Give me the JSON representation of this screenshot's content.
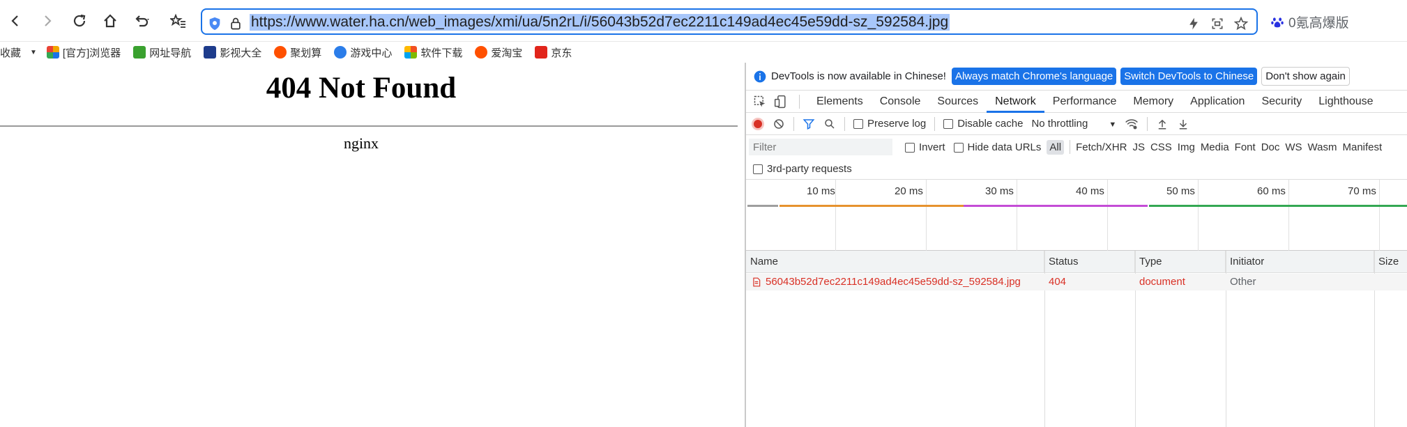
{
  "browser": {
    "url": "https://www.water.ha.cn/web_images/xmi/ua/5n2rL/i/56043b52d7ec2211c149ad4ec45e59dd-sz_592584.jpg",
    "search_text": "0氪高爆版"
  },
  "bookmarks": [
    {
      "label": "收藏",
      "icon": "star-folder-icon",
      "color": "#f2a600"
    },
    {
      "label": "[官方]浏览器",
      "icon": "grid-icon",
      "color": "#f2a600"
    },
    {
      "label": "网址导航",
      "icon": "2345-icon",
      "color": "#3aa12f"
    },
    {
      "label": "影视大全",
      "icon": "film-icon",
      "color": "#1e6cd8"
    },
    {
      "label": "聚划算",
      "icon": "taobao-icon",
      "color": "#ff5000"
    },
    {
      "label": "游戏中心",
      "icon": "game-icon",
      "color": "#2b7de9"
    },
    {
      "label": "软件下载",
      "icon": "apps-icon",
      "color": "#f25022"
    },
    {
      "label": "爱淘宝",
      "icon": "taobao-icon",
      "color": "#ff5000"
    },
    {
      "label": "京东",
      "icon": "jd-icon",
      "color": "#e1251b"
    }
  ],
  "page": {
    "title": "404 Not Found",
    "server": "nginx"
  },
  "devtools": {
    "info": "DevTools is now available in Chinese!",
    "btn_match": "Always match Chrome's language",
    "btn_switch": "Switch DevTools to Chinese",
    "btn_dismiss": "Don't show again",
    "tabs": [
      "Elements",
      "Console",
      "Sources",
      "Network",
      "Performance",
      "Memory",
      "Application",
      "Security",
      "Lighthouse"
    ],
    "active_tab": "Network",
    "preserve_log": "Preserve log",
    "disable_cache": "Disable cache",
    "throttling": "No throttling",
    "filter_placeholder": "Filter",
    "invert": "Invert",
    "hide_data_urls": "Hide data URLs",
    "filter_types": [
      "All",
      "Fetch/XHR",
      "JS",
      "CSS",
      "Img",
      "Media",
      "Font",
      "Doc",
      "WS",
      "Wasm",
      "Manifest"
    ],
    "third_party": "3rd-party requests",
    "ticks": [
      "10 ms",
      "20 ms",
      "30 ms",
      "40 ms",
      "50 ms",
      "60 ms",
      "70 ms"
    ],
    "columns": {
      "name": "Name",
      "status": "Status",
      "type": "Type",
      "initiator": "Initiator",
      "size": "Size"
    },
    "rows": [
      {
        "name": "56043b52d7ec2211c149ad4ec45e59dd-sz_592584.jpg",
        "status": "404",
        "type": "document",
        "initiator": "Other"
      }
    ]
  }
}
